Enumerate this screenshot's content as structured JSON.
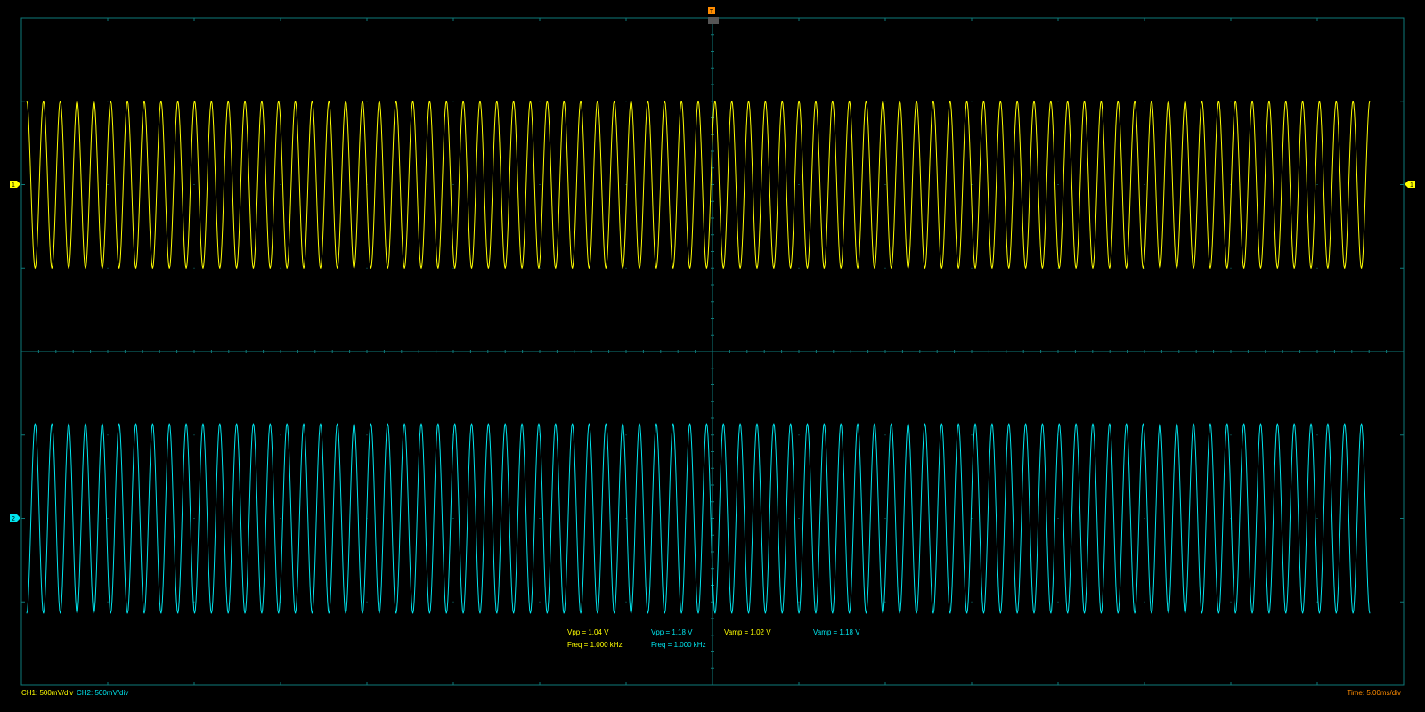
{
  "colors": {
    "ch1": "#ffff00",
    "ch2": "#00e5ee",
    "grid": "#0e7a7a",
    "trigger": "#ff8c00",
    "background": "#000000"
  },
  "channel_markers": {
    "ch1_left": "1",
    "ch1_right": "1",
    "ch2_left": "2"
  },
  "trigger_marker": {
    "icon": "trigger-t-icon",
    "label": "T"
  },
  "measurements": {
    "ch1_vpp": "Vpp = 1.04 V",
    "ch1_freq": "Freq = 1.000 kHz",
    "ch2_vpp": "Vpp = 1.18 V",
    "ch2_freq": "Freq = 1.000 kHz",
    "ch1_vamp": "Vamp = 1.02 V",
    "ch2_vamp": "Vamp = 1.18 V"
  },
  "status_bar": {
    "ch1_scale": "CH1: 500mV/div",
    "ch2_scale": "CH2: 500mV/div",
    "timebase": "Time: 5.00ms/div"
  },
  "chart_data": {
    "type": "line",
    "grid": true,
    "divisions": {
      "horizontal": 16,
      "vertical": 8
    },
    "series": [
      {
        "name": "CH1",
        "color": "#ffff00",
        "cycles": 80,
        "vpp": 1.04,
        "frequency_khz": 1.0,
        "offset_div": 2.0
      },
      {
        "name": "CH2",
        "color": "#00e5ee",
        "cycles": 80,
        "vpp": 1.18,
        "frequency_khz": 1.0,
        "offset_div": -2.0
      }
    ]
  }
}
